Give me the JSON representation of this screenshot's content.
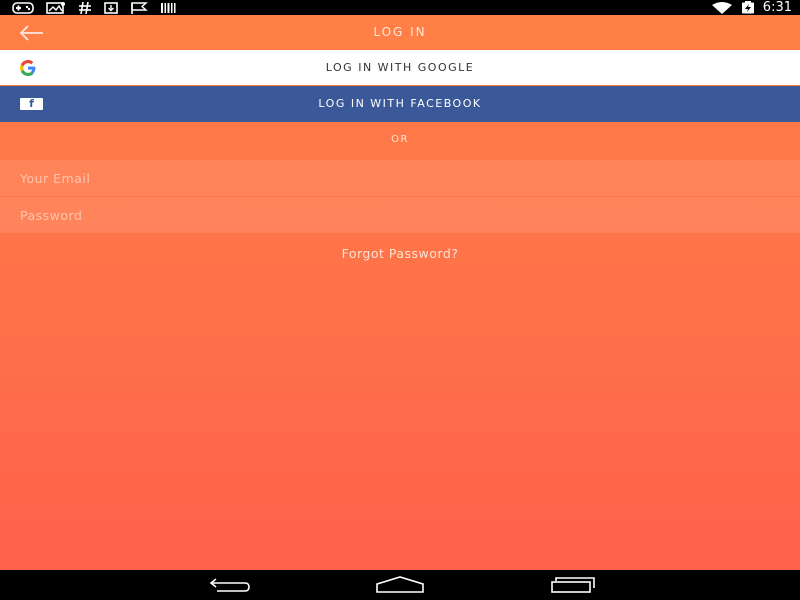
{
  "statusbar": {
    "time": "6:31",
    "left_icons": [
      "gamepad-icon",
      "image-icon",
      "hashtag-icon",
      "download-icon",
      "flag-icon",
      "barcode-icon"
    ],
    "right_icons": [
      "wifi-icon",
      "battery-charging-icon"
    ]
  },
  "appbar": {
    "title": "LOG IN",
    "back_icon": "arrow-left-icon"
  },
  "social": {
    "google_label": "LOG IN WITH GOOGLE",
    "google_icon": "google-g-icon",
    "facebook_label": "LOG IN WITH FACEBOOK",
    "facebook_icon": "facebook-f-icon",
    "facebook_icon_glyph": "f"
  },
  "divider": {
    "or_label": "OR"
  },
  "form": {
    "email": {
      "value": "",
      "placeholder": "Your Email"
    },
    "password": {
      "value": "",
      "placeholder": "Password"
    },
    "forgot_label": "Forgot Password?"
  },
  "navbar": {
    "icons": [
      "back-nav-icon",
      "home-nav-icon",
      "recents-nav-icon"
    ]
  },
  "colors": {
    "accent": "#FF7F47",
    "facebook": "#3B5998",
    "background_top": "#FF7F47",
    "background_bottom": "#FF604B"
  }
}
